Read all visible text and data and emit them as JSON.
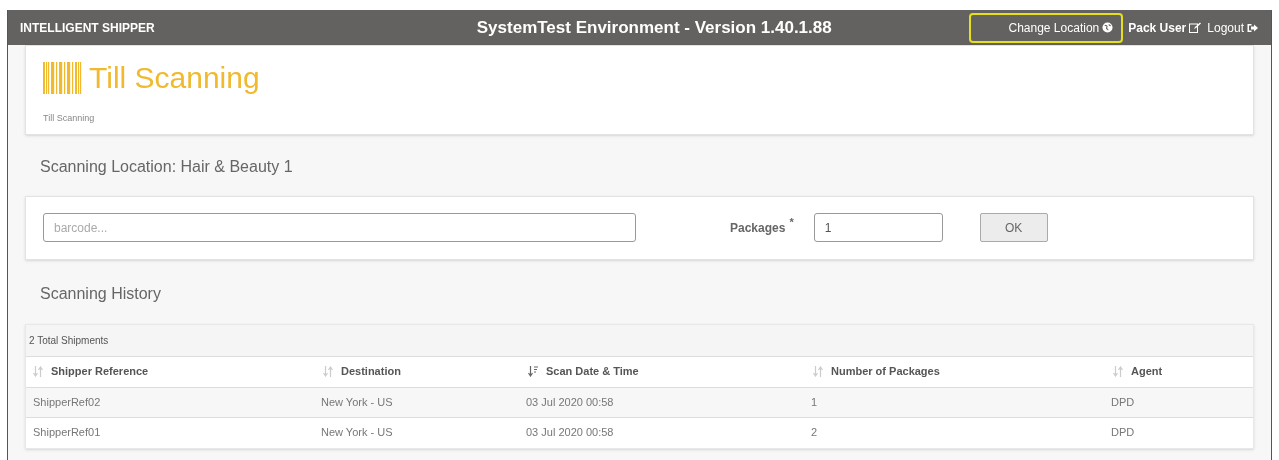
{
  "header": {
    "brand": "INTELLIGENT SHIPPER",
    "title": "SystemTest Environment - Version 1.40.1.88",
    "links": [
      {
        "label": "Change Location",
        "kind": "location",
        "focused": true
      },
      {
        "label": "Pack User",
        "kind": "user",
        "focused": false
      },
      {
        "label": "Logout",
        "kind": "logout",
        "focused": false
      }
    ]
  },
  "page": {
    "title": "Till Scanning",
    "breadcrumb": "Till Scanning"
  },
  "location": "Scanning Location: Hair & Beauty 1",
  "scan_form": {
    "barcode": {
      "placeholder": "barcode..."
    },
    "packages": {
      "label": "Packages",
      "required_mark": "*",
      "value": "1"
    },
    "ok_button": "OK"
  },
  "history": {
    "title": "Scanning History",
    "total": "2 Total Shipments",
    "columns": [
      {
        "label": "Shipper Reference",
        "sorted": false
      },
      {
        "label": "Destination",
        "sorted": false
      },
      {
        "label": "Scan Date & Time",
        "sorted": true
      },
      {
        "label": "Number of Packages",
        "sorted": false
      },
      {
        "label": "Agent",
        "sorted": false
      }
    ],
    "rows": [
      [
        "ShipperRef02",
        "New York - US",
        "03 Jul 2020 00:58",
        "1",
        "DPD"
      ],
      [
        "ShipperRef01",
        "New York - US",
        "03 Jul 2020 00:58",
        "2",
        "DPD"
      ]
    ]
  }
}
